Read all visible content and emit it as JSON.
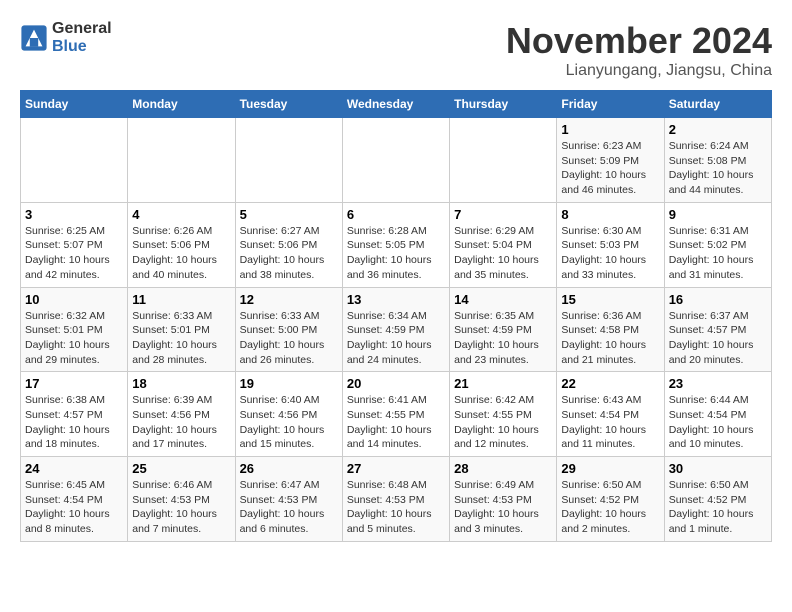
{
  "logo": {
    "line1": "General",
    "line2": "Blue"
  },
  "title": "November 2024",
  "location": "Lianyungang, Jiangsu, China",
  "weekdays": [
    "Sunday",
    "Monday",
    "Tuesday",
    "Wednesday",
    "Thursday",
    "Friday",
    "Saturday"
  ],
  "weeks": [
    [
      {
        "day": "",
        "info": ""
      },
      {
        "day": "",
        "info": ""
      },
      {
        "day": "",
        "info": ""
      },
      {
        "day": "",
        "info": ""
      },
      {
        "day": "",
        "info": ""
      },
      {
        "day": "1",
        "info": "Sunrise: 6:23 AM\nSunset: 5:09 PM\nDaylight: 10 hours and 46 minutes."
      },
      {
        "day": "2",
        "info": "Sunrise: 6:24 AM\nSunset: 5:08 PM\nDaylight: 10 hours and 44 minutes."
      }
    ],
    [
      {
        "day": "3",
        "info": "Sunrise: 6:25 AM\nSunset: 5:07 PM\nDaylight: 10 hours and 42 minutes."
      },
      {
        "day": "4",
        "info": "Sunrise: 6:26 AM\nSunset: 5:06 PM\nDaylight: 10 hours and 40 minutes."
      },
      {
        "day": "5",
        "info": "Sunrise: 6:27 AM\nSunset: 5:06 PM\nDaylight: 10 hours and 38 minutes."
      },
      {
        "day": "6",
        "info": "Sunrise: 6:28 AM\nSunset: 5:05 PM\nDaylight: 10 hours and 36 minutes."
      },
      {
        "day": "7",
        "info": "Sunrise: 6:29 AM\nSunset: 5:04 PM\nDaylight: 10 hours and 35 minutes."
      },
      {
        "day": "8",
        "info": "Sunrise: 6:30 AM\nSunset: 5:03 PM\nDaylight: 10 hours and 33 minutes."
      },
      {
        "day": "9",
        "info": "Sunrise: 6:31 AM\nSunset: 5:02 PM\nDaylight: 10 hours and 31 minutes."
      }
    ],
    [
      {
        "day": "10",
        "info": "Sunrise: 6:32 AM\nSunset: 5:01 PM\nDaylight: 10 hours and 29 minutes."
      },
      {
        "day": "11",
        "info": "Sunrise: 6:33 AM\nSunset: 5:01 PM\nDaylight: 10 hours and 28 minutes."
      },
      {
        "day": "12",
        "info": "Sunrise: 6:33 AM\nSunset: 5:00 PM\nDaylight: 10 hours and 26 minutes."
      },
      {
        "day": "13",
        "info": "Sunrise: 6:34 AM\nSunset: 4:59 PM\nDaylight: 10 hours and 24 minutes."
      },
      {
        "day": "14",
        "info": "Sunrise: 6:35 AM\nSunset: 4:59 PM\nDaylight: 10 hours and 23 minutes."
      },
      {
        "day": "15",
        "info": "Sunrise: 6:36 AM\nSunset: 4:58 PM\nDaylight: 10 hours and 21 minutes."
      },
      {
        "day": "16",
        "info": "Sunrise: 6:37 AM\nSunset: 4:57 PM\nDaylight: 10 hours and 20 minutes."
      }
    ],
    [
      {
        "day": "17",
        "info": "Sunrise: 6:38 AM\nSunset: 4:57 PM\nDaylight: 10 hours and 18 minutes."
      },
      {
        "day": "18",
        "info": "Sunrise: 6:39 AM\nSunset: 4:56 PM\nDaylight: 10 hours and 17 minutes."
      },
      {
        "day": "19",
        "info": "Sunrise: 6:40 AM\nSunset: 4:56 PM\nDaylight: 10 hours and 15 minutes."
      },
      {
        "day": "20",
        "info": "Sunrise: 6:41 AM\nSunset: 4:55 PM\nDaylight: 10 hours and 14 minutes."
      },
      {
        "day": "21",
        "info": "Sunrise: 6:42 AM\nSunset: 4:55 PM\nDaylight: 10 hours and 12 minutes."
      },
      {
        "day": "22",
        "info": "Sunrise: 6:43 AM\nSunset: 4:54 PM\nDaylight: 10 hours and 11 minutes."
      },
      {
        "day": "23",
        "info": "Sunrise: 6:44 AM\nSunset: 4:54 PM\nDaylight: 10 hours and 10 minutes."
      }
    ],
    [
      {
        "day": "24",
        "info": "Sunrise: 6:45 AM\nSunset: 4:54 PM\nDaylight: 10 hours and 8 minutes."
      },
      {
        "day": "25",
        "info": "Sunrise: 6:46 AM\nSunset: 4:53 PM\nDaylight: 10 hours and 7 minutes."
      },
      {
        "day": "26",
        "info": "Sunrise: 6:47 AM\nSunset: 4:53 PM\nDaylight: 10 hours and 6 minutes."
      },
      {
        "day": "27",
        "info": "Sunrise: 6:48 AM\nSunset: 4:53 PM\nDaylight: 10 hours and 5 minutes."
      },
      {
        "day": "28",
        "info": "Sunrise: 6:49 AM\nSunset: 4:53 PM\nDaylight: 10 hours and 3 minutes."
      },
      {
        "day": "29",
        "info": "Sunrise: 6:50 AM\nSunset: 4:52 PM\nDaylight: 10 hours and 2 minutes."
      },
      {
        "day": "30",
        "info": "Sunrise: 6:50 AM\nSunset: 4:52 PM\nDaylight: 10 hours and 1 minute."
      }
    ]
  ]
}
